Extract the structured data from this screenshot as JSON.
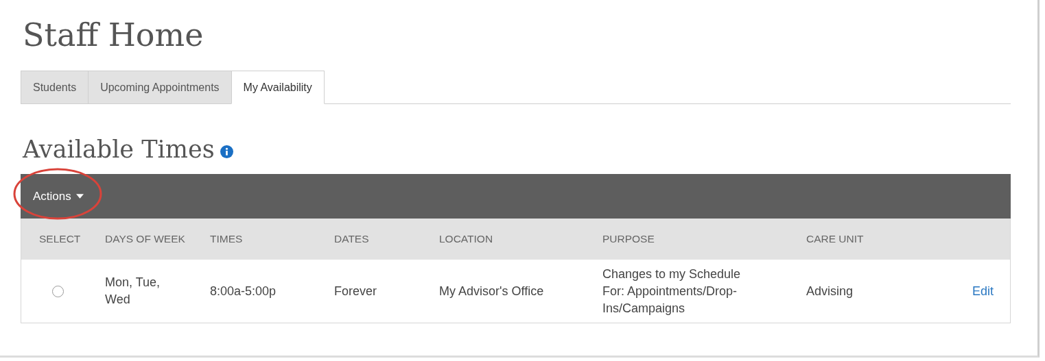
{
  "page": {
    "title": "Staff Home"
  },
  "tabs": [
    {
      "label": "Students",
      "selected": false
    },
    {
      "label": "Upcoming Appointments",
      "selected": false
    },
    {
      "label": "My Availability",
      "selected": true
    }
  ],
  "section": {
    "title": "Available Times",
    "info": true
  },
  "toolbar": {
    "actions_label": "Actions",
    "highlighted": true
  },
  "table": {
    "columns": [
      "SELECT",
      "DAYS OF WEEK",
      "TIMES",
      "DATES",
      "LOCATION",
      "PURPOSE",
      "CARE UNIT"
    ],
    "rows": [
      {
        "selected": false,
        "days": "Mon, Tue, Wed",
        "times": "8:00a-5:00p",
        "dates": "Forever",
        "location": "My Advisor's Office",
        "purpose": "Changes to my Schedule For: Appointments/Drop-Ins/Campaigns",
        "care_unit": "Advising",
        "action": "Edit"
      }
    ]
  }
}
